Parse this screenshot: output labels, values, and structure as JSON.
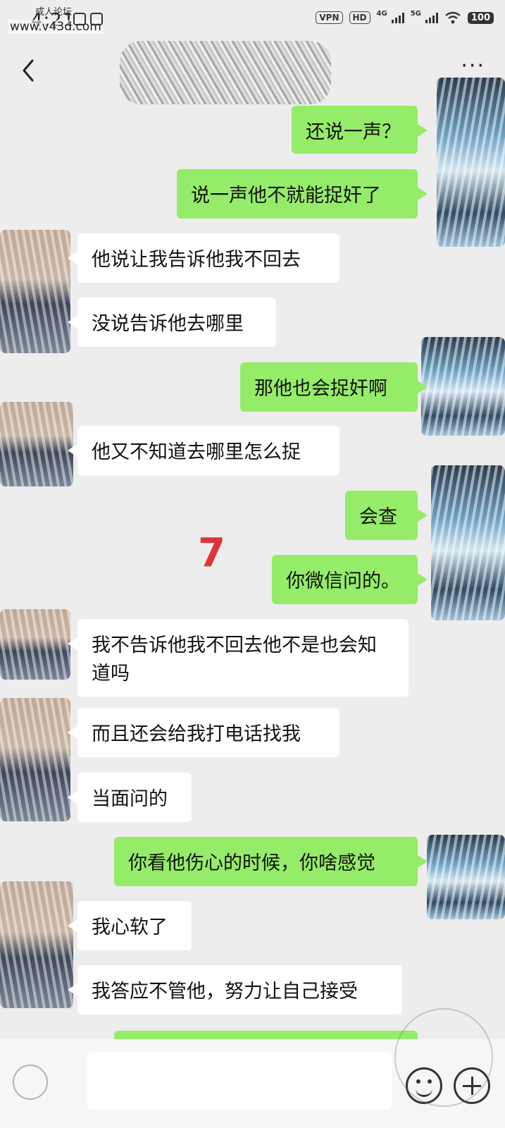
{
  "status_bar": {
    "time": "4:21",
    "watermark_site": "www.v43d.com",
    "watermark_forum": "成人论坛",
    "vpn": "VPN",
    "hd": "HD",
    "net1": "4G",
    "net2": "5G",
    "battery": "100"
  },
  "header": {
    "back_icon": "chevron-left-icon",
    "more_icon": "more-dots-icon",
    "more_label": "···"
  },
  "messages": [
    {
      "side": "out",
      "text": "还说一声？"
    },
    {
      "side": "out",
      "text": "说一声他不就能捉奸了"
    },
    {
      "side": "in",
      "text": "他说让我告诉他我不回去"
    },
    {
      "side": "in",
      "text": "没说告诉他去哪里"
    },
    {
      "side": "out",
      "text": "那他也会捉奸啊"
    },
    {
      "side": "in",
      "text": "他又不知道去哪里怎么捉"
    },
    {
      "side": "out",
      "text": "会查"
    },
    {
      "side": "out",
      "text": "你微信问的。"
    },
    {
      "side": "in",
      "text": "我不告诉他我不回去他不是也会知道吗"
    },
    {
      "side": "in",
      "text": "而且还会给我打电话找我"
    },
    {
      "side": "in",
      "text": "当面问的"
    },
    {
      "side": "out",
      "text": "你看他伤心的时候，你啥感觉"
    },
    {
      "side": "in",
      "text": "我心软了"
    },
    {
      "side": "in",
      "text": "我答应不管他，努力让自己接受"
    }
  ],
  "annotation_marker": "7",
  "input_bar": {
    "voice_icon": "voice-icon",
    "emoji_icon": "emoji-icon",
    "plus_icon": "plus-icon"
  },
  "colors": {
    "outgoing_bubble": "#95ec69",
    "incoming_bubble": "#ffffff",
    "background": "#ededed",
    "marker": "#e0343a"
  }
}
